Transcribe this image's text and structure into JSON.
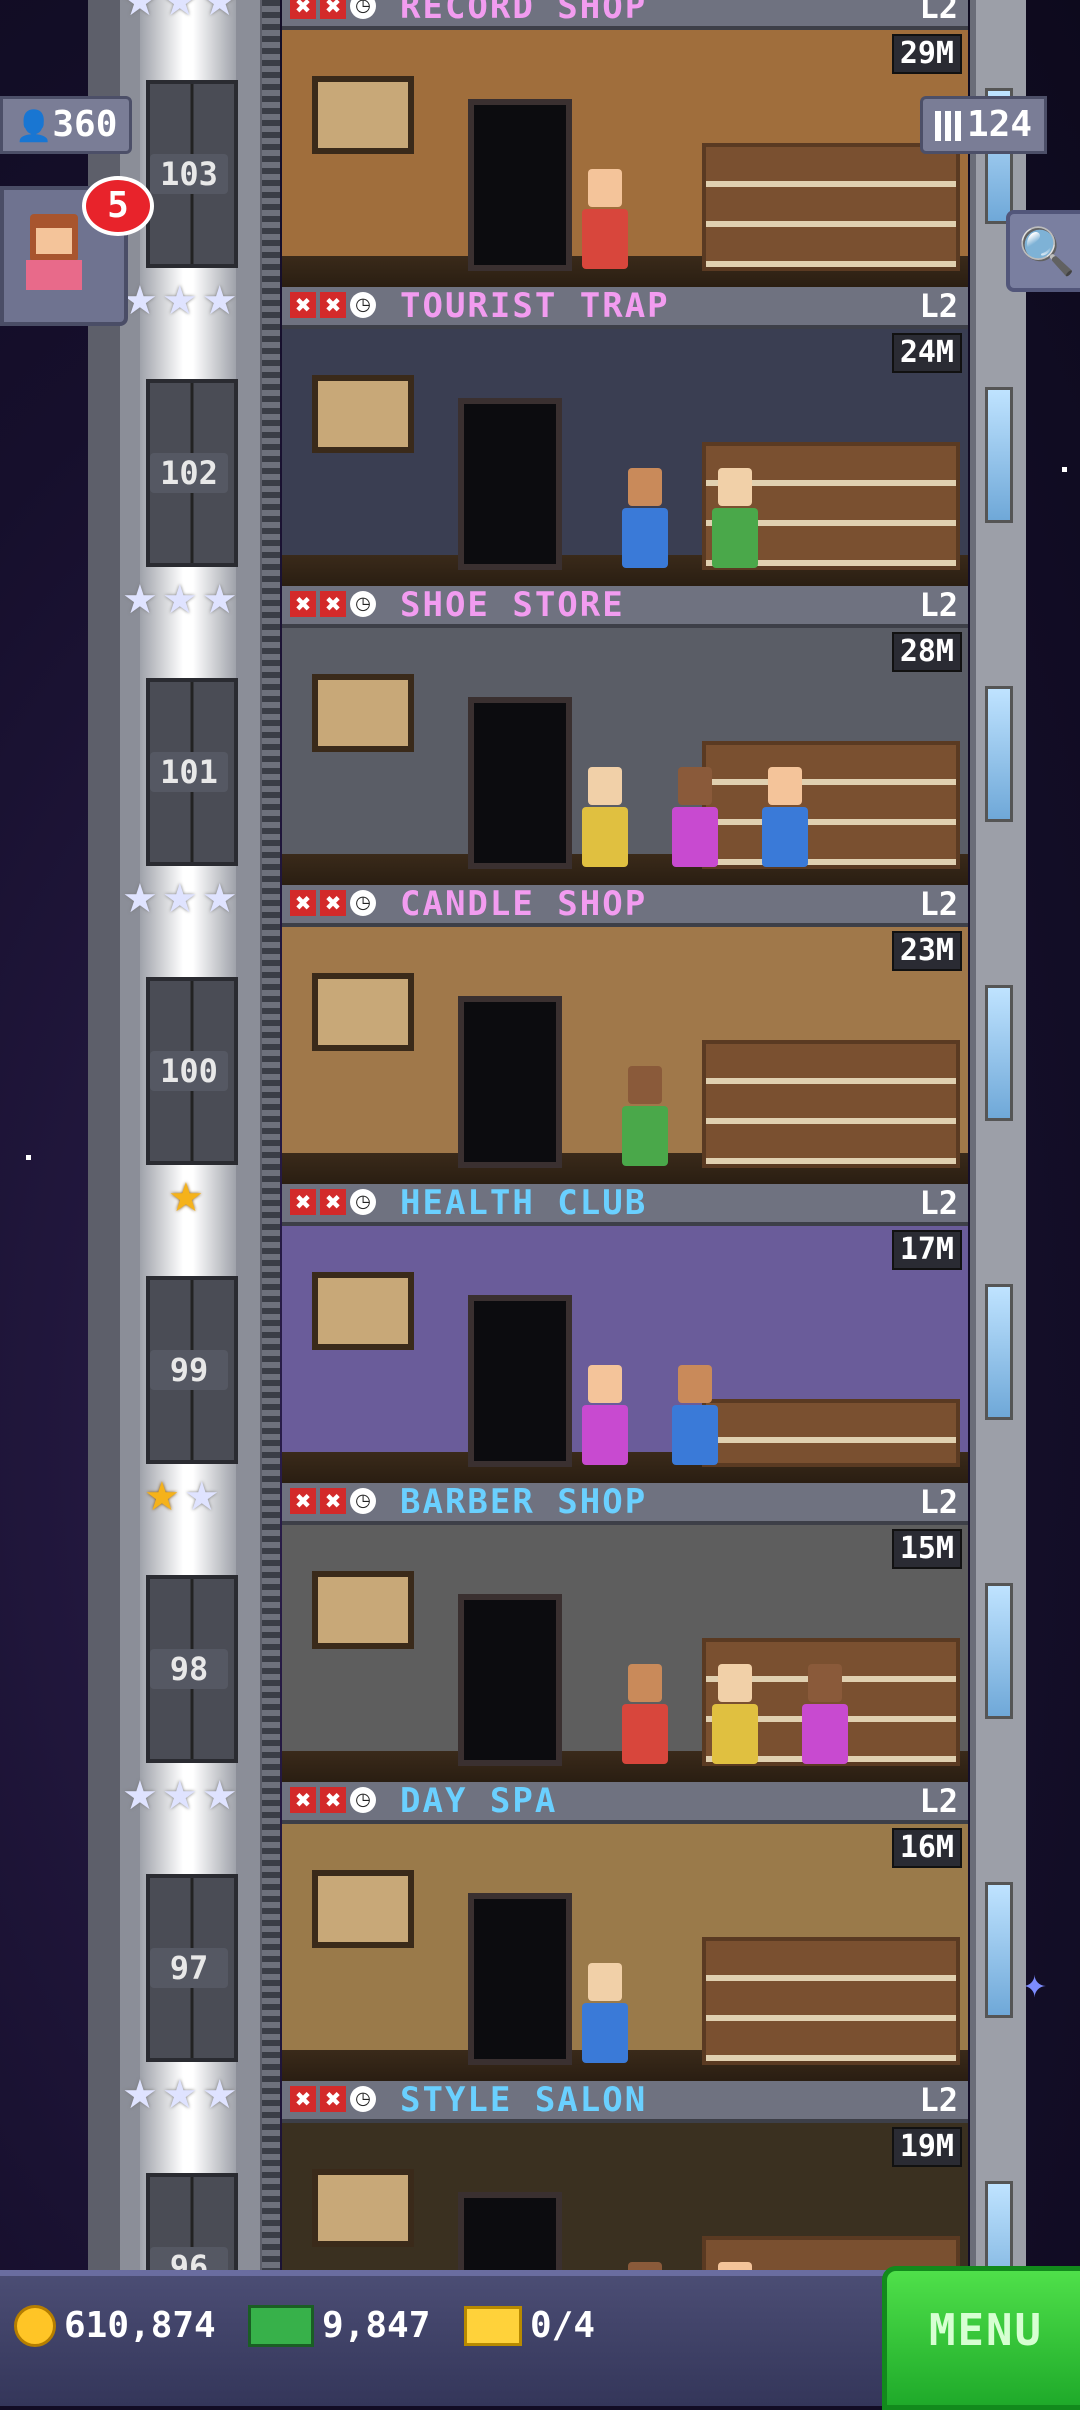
{
  "hud": {
    "population": "360",
    "floors_count": "124",
    "bitizen_badge": "5"
  },
  "icons": {
    "population": "person-icon",
    "floors": "building-icon",
    "search": "magnifier-icon",
    "coins": "coin-icon",
    "bux": "bux-icon",
    "tickets": "ticket-icon"
  },
  "floors": [
    {
      "name": "RECORD SHOP",
      "level": "L2",
      "time": "29M",
      "number": "103",
      "stars": 3,
      "gold": 0,
      "color": "#f29cf0",
      "wall": "#a06e3c"
    },
    {
      "name": "TOURIST TRAP",
      "level": "L2",
      "time": "24M",
      "number": "102",
      "stars": 3,
      "gold": 0,
      "color": "#f29cf0",
      "wall": "#3a3e52"
    },
    {
      "name": "SHOE STORE",
      "level": "L2",
      "time": "28M",
      "number": "101",
      "stars": 3,
      "gold": 0,
      "color": "#f29cf0",
      "wall": "#5a5d66"
    },
    {
      "name": "CANDLE SHOP",
      "level": "L2",
      "time": "23M",
      "number": "100",
      "stars": 3,
      "gold": 0,
      "color": "#f29cf0",
      "wall": "#a0784a"
    },
    {
      "name": "HEALTH CLUB",
      "level": "L2",
      "time": "17M",
      "number": "99",
      "stars": 1,
      "gold": 1,
      "color": "#6ad0ff",
      "wall": "#6a5c9a"
    },
    {
      "name": "BARBER SHOP",
      "level": "L2",
      "time": "15M",
      "number": "98",
      "stars": 2,
      "gold": 1,
      "color": "#6ad0ff",
      "wall": "#5e5e5e"
    },
    {
      "name": "DAY SPA",
      "level": "L2",
      "time": "16M",
      "number": "97",
      "stars": 3,
      "gold": 0,
      "color": "#6ad0ff",
      "wall": "#9a7a4a"
    },
    {
      "name": "STYLE SALON",
      "level": "L2",
      "time": "19M",
      "number": "96",
      "stars": 3,
      "gold": 0,
      "color": "#6ad0ff",
      "wall": "#3a3020"
    }
  ],
  "bottom": {
    "coins": "610,874",
    "bux": "9,847",
    "tickets": "0/4",
    "menu_label": "MENU"
  },
  "colors": {
    "bux_accent": "#37b14a",
    "coin_accent": "#ffc526",
    "menu_green": "#1faa2a"
  }
}
